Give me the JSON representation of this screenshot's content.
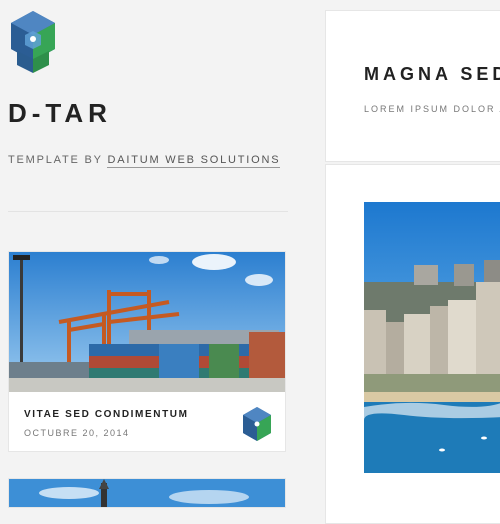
{
  "site": {
    "title": "D-TAR",
    "tagline_prefix": "TEMPLATE BY ",
    "tagline_link": "DAITUM WEB SOLUTIONS"
  },
  "cards": [
    {
      "title": "VITAE SED CONDIMENTUM",
      "date": "OCTUBRE 20, 2014",
      "image": "container-port-cranes-photo",
      "avatar": "hex-cube-logo-icon"
    },
    {
      "image": "blue-sky-tower-photo"
    }
  ],
  "main": {
    "post_title": "MAGNA SED",
    "post_subtitle": "LOREM IPSUM DOLOR A",
    "image": "coastal-city-skyline-photo"
  },
  "colors": {
    "background": "#f3f3f3",
    "panel": "#ffffff",
    "logo_blue": "#2f6fa8",
    "logo_green": "#3a9c52",
    "sky": "#2a86d0",
    "sea": "#1f7fb4"
  }
}
